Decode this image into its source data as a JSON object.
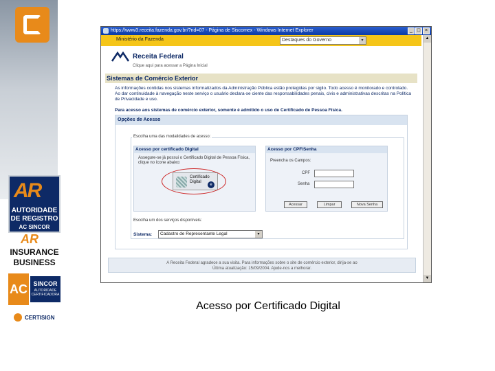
{
  "branding": {
    "ar_letters": "AR",
    "ar_lines": [
      "AUTORIDADE",
      "DE REGISTRO",
      "AC SINCOR"
    ],
    "insurance_ar": "AR",
    "insurance_lines": [
      "INSURANCE",
      "BUSINESS"
    ],
    "ac_letters": "AC",
    "sincor": "SINCOR",
    "sincor_sub": "AUTORIDADE CERTIFICADORA",
    "certisign": "CERTISIGN"
  },
  "window": {
    "title": "https://www3.receita.fazenda.gov.br/?nd=07 - Página de Siscomex - Windows Internet Explorer",
    "min": "_",
    "max": "□",
    "close": "×"
  },
  "govbar": {
    "label": "Ministério da Fazenda",
    "select_value": "Destaques do Governo",
    "arrow": "▾"
  },
  "site": {
    "brand": "Receita Federal",
    "home_link": "Clique aqui para acessar a Página Inicial"
  },
  "section": {
    "title": "Sistemas de Comércio Exterior",
    "notice": "As informações contidas nos sistemas informatizados da Administração Pública estão protegidas por sigilo. Todo acesso é monitorado e controlado. Ao dar continuidade à navegação neste serviço o usuário declara-se ciente das responsabilidades penais, civis e administrativas descritas na Política de Privacidade e uso.",
    "access_note": "Para acesso aos sistemas de comércio exterior, somente é admitido o uso de Certificado de Pessoa Física."
  },
  "options": {
    "header": "Opções de Acesso",
    "legend": "Escolha uma das modalidades de acesso:",
    "cert": {
      "title": "Acesso por certificado Digital",
      "desc": "Assegure-se já possui o Certificado Digital de Pessoa Física, clique no ícone abaixo:",
      "badge_line1": "Certificado",
      "badge_line2": "Digital",
      "seal": "e"
    },
    "cpf": {
      "title": "Acesso por CPF/Senha",
      "hint": "Preencha os Campos:",
      "cpf_label": "CPF",
      "senha_label": "Senha",
      "btn_enter": "Acessar",
      "btn_clear": "Limpar",
      "btn_new": "Nova Senha"
    },
    "services_label": "Escolha um dos serviços disponíveis:",
    "sistema_label": "Sistema:",
    "sistema_value": "Cadastro de Representante Legal",
    "arrow": "▾"
  },
  "footer": {
    "line1": "A Receita Federal agradece a sua visita. Para informações sobre o site de comércio exterior, dirija-se ao",
    "line2": "Última atualização: 15/09/2004. Ajude-nos a melhorar."
  },
  "scroll": {
    "up": "▲",
    "down": "▼"
  },
  "caption": "Acesso por Certificado Digital"
}
